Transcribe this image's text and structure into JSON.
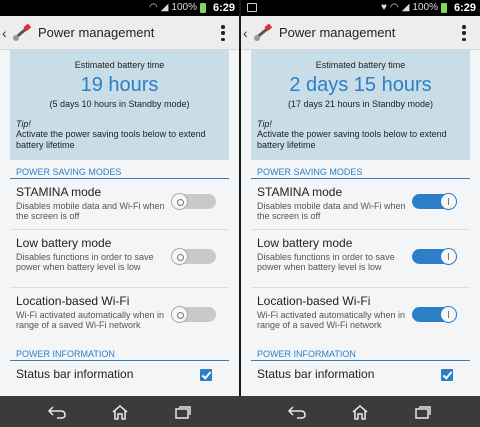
{
  "screens": [
    {
      "status_bar": {
        "battery_percent": "100%",
        "time": "6:29"
      },
      "action_bar": {
        "title": "Power management"
      },
      "battery": {
        "label": "Estimated battery time",
        "value": "19 hours",
        "standby": "(5 days 10 hours in Standby mode)",
        "tip_title": "Tip!",
        "tip_text": "Activate the power saving tools below to extend battery lifetime"
      },
      "sections": {
        "power_saving": "POWER SAVING MODES",
        "power_info": "POWER INFORMATION"
      },
      "settings": [
        {
          "title": "STAMINA mode",
          "desc": "Disables mobile data and Wi-Fi when the screen is off",
          "enabled": false
        },
        {
          "title": "Low battery mode",
          "desc": "Disables functions in order to save power when battery level is low",
          "enabled": false
        },
        {
          "title": "Location-based Wi-Fi",
          "desc": "Wi-Fi activated automatically when in range of a saved Wi-Fi network",
          "enabled": false
        }
      ],
      "status_bar_info": {
        "title": "Status bar information",
        "checked": true
      }
    },
    {
      "status_bar": {
        "battery_percent": "100%",
        "time": "6:29"
      },
      "action_bar": {
        "title": "Power management"
      },
      "battery": {
        "label": "Estimated battery time",
        "value": "2 days 15 hours",
        "standby": "(17 days 21 hours in Standby mode)",
        "tip_title": "Tip!",
        "tip_text": "Activate the power saving tools below to extend battery lifetime"
      },
      "sections": {
        "power_saving": "POWER SAVING MODES",
        "power_info": "POWER INFORMATION"
      },
      "settings": [
        {
          "title": "STAMINA mode",
          "desc": "Disables mobile data and Wi-Fi when the screen is off",
          "enabled": true
        },
        {
          "title": "Low battery mode",
          "desc": "Disables functions in order to save power when battery level is low",
          "enabled": true
        },
        {
          "title": "Location-based Wi-Fi",
          "desc": "Wi-Fi activated automatically when in range of a saved Wi-Fi network",
          "enabled": true
        }
      ],
      "status_bar_info": {
        "title": "Status bar information",
        "checked": true
      }
    }
  ],
  "colors": {
    "accent": "#2c7fc7",
    "card_bg": "#c9dde8",
    "nav_bg": "#3b3b3b"
  },
  "icons": {
    "back": "chevron-left-icon",
    "app": "power-tools-icon",
    "overflow": "overflow-menu-icon",
    "nav": [
      "back-icon",
      "home-icon",
      "recents-icon"
    ]
  }
}
